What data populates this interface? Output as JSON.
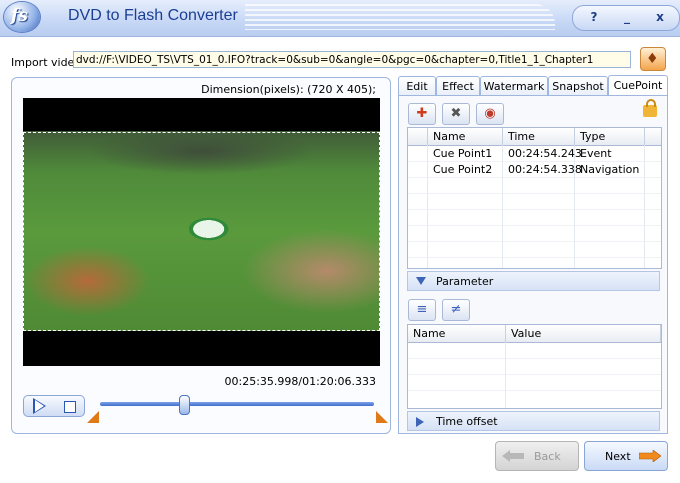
{
  "window": {
    "title": "DVD to Flash Converter",
    "logo_text": "fs",
    "controls": {
      "help": "?",
      "minimize": "_",
      "close": "x"
    }
  },
  "import": {
    "label": "Import video:",
    "value": "dvd://F:\\VIDEO_TS\\VTS_01_0.IFO?track=0&sub=0&angle=0&pgc=0&chapter=0,Title1_1_Chapter1",
    "button_icon": "import-icon"
  },
  "preview": {
    "dimension": "Dimension(pixels): (720 X 405);",
    "time": "00:25:35.998/01:20:06.333",
    "slider_position": 0.31
  },
  "tabs": [
    {
      "label": "Edit",
      "active": false
    },
    {
      "label": "Effect",
      "active": false
    },
    {
      "label": "Watermark",
      "active": false
    },
    {
      "label": "Snapshot",
      "active": false
    },
    {
      "label": "CuePoint",
      "active": true
    }
  ],
  "cuepoint": {
    "toolbar_icons": [
      "add-cuepoint-icon",
      "delete-cuepoint-icon",
      "clear-cuepoints-icon",
      "lock-icon"
    ],
    "columns": {
      "name": "Name",
      "time": "Time",
      "type": "Type"
    },
    "rows": [
      {
        "name": "Cue Point1",
        "time": "00:24:54.243",
        "type": "Event"
      },
      {
        "name": "Cue Point2",
        "time": "00:24:54.338",
        "type": "Navigation"
      }
    ],
    "parameter": {
      "header": "Parameter",
      "toolbar_icons": [
        "add-parameter-icon",
        "delete-parameter-icon"
      ],
      "columns": {
        "name": "Name",
        "value": "Value"
      }
    },
    "time_offset": {
      "header": "Time offset"
    }
  },
  "footer": {
    "back_label": "Back",
    "next_label": "Next"
  },
  "colors": {
    "accent": "#3e64b8",
    "title_text": "#1c3f94",
    "input_bg": "#fffde8",
    "marker_orange": "#e07a18"
  }
}
